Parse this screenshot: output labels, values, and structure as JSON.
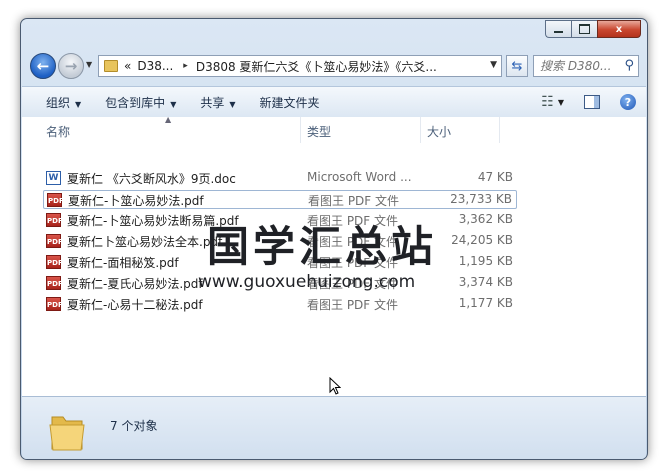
{
  "window": {
    "caption_buttons": {
      "minimize": "",
      "maximize": "",
      "close": "x"
    }
  },
  "nav": {
    "back_icon": "arrow-left-icon",
    "forward_icon": "arrow-right-icon",
    "address": {
      "overflow": "«",
      "crumbs": [
        "D38...",
        "D3808 夏新仁六爻《卜筮心易妙法》《六爻..."
      ],
      "separator": "▸"
    },
    "search_placeholder": "搜索 D380..."
  },
  "toolbar": {
    "organize": "组织",
    "include_in_library": "包含到库中",
    "share": "共享",
    "new_folder": "新建文件夹"
  },
  "columns": {
    "name": "名称",
    "type": "类型",
    "size": "大小"
  },
  "files": [
    {
      "name": "夏新仁 《六爻断风水》9页.doc",
      "type": "Microsoft Word ...",
      "size": "47 KB",
      "icon": "word-doc-icon"
    },
    {
      "name": "夏新仁-卜筮心易妙法.pdf",
      "type": "看图王 PDF 文件",
      "size": "23,733 KB",
      "icon": "pdf-file-icon"
    },
    {
      "name": "夏新仁-卜筮心易妙法断易篇.pdf",
      "type": "看图王 PDF 文件",
      "size": "3,362 KB",
      "icon": "pdf-file-icon"
    },
    {
      "name": "夏新仁卜筮心易妙法全本.pdf",
      "type": "看图王 PDF 文件",
      "size": "24,205 KB",
      "icon": "pdf-file-icon"
    },
    {
      "name": "夏新仁-面相秘笈.pdf",
      "type": "看图王 PDF 文件",
      "size": "1,195 KB",
      "icon": "pdf-file-icon"
    },
    {
      "name": "夏新仁-夏氏心易妙法.pdf",
      "type": "看图王 PDF 文件",
      "size": "3,374 KB",
      "icon": "pdf-file-icon"
    },
    {
      "name": "夏新仁-心易十二秘法.pdf",
      "type": "看图王 PDF 文件",
      "size": "1,177 KB",
      "icon": "pdf-file-icon"
    }
  ],
  "selected_index": 1,
  "watermark": {
    "title": "国学汇总站",
    "url": "www.guoxuehuizong.com"
  },
  "status": {
    "count": "7 个对象"
  },
  "colors": {
    "accent": "#1d5fc4",
    "selection_border": "#9eb6d4",
    "frame": "#c9d9ec"
  }
}
